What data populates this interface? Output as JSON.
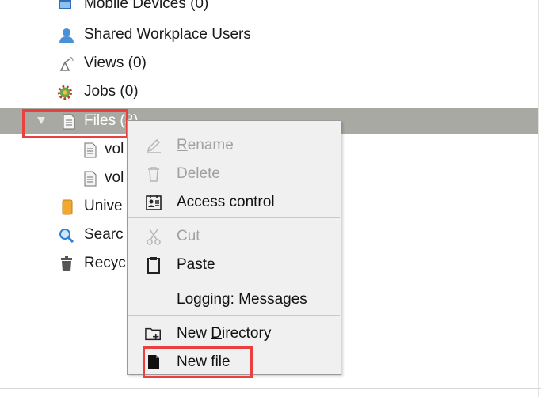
{
  "tree": {
    "items": [
      {
        "label": "Mobile Devices (0)",
        "icon": "mobile-devices-icon"
      },
      {
        "label": "Shared Workplace Users",
        "icon": "user-icon"
      },
      {
        "label": "Views (0)",
        "icon": "views-satellite-icon"
      },
      {
        "label": "Jobs (0)",
        "icon": "jobs-gear-icon"
      },
      {
        "label": "Files (3)",
        "label_short": "Files",
        "icon": "file-icon",
        "expanded": true,
        "selected": true
      },
      {
        "label": "vol",
        "icon": "file-icon"
      },
      {
        "label": "vol",
        "icon": "file-icon"
      },
      {
        "label": "Unive",
        "icon": "universe-book-icon"
      },
      {
        "label": "Searc",
        "icon": "search-icon"
      },
      {
        "label": "Recyc",
        "icon": "trash-icon"
      }
    ]
  },
  "context_menu": {
    "items": [
      {
        "label_pre": "",
        "label_ul": "R",
        "label_post": "ename",
        "enabled": false,
        "icon": "rename-pencil-icon"
      },
      {
        "label": "Delete",
        "enabled": false,
        "icon": "delete-trash-icon"
      },
      {
        "label": "Access control",
        "enabled": true,
        "icon": "access-control-icon"
      },
      {
        "label": "Cut",
        "enabled": false,
        "icon": "scissors-icon"
      },
      {
        "label": "Paste",
        "enabled": true,
        "icon": "clipboard-icon"
      },
      {
        "label": "Logging: Messages",
        "enabled": true
      },
      {
        "label_pre": "New ",
        "label_ul": "D",
        "label_post": "irectory",
        "enabled": true,
        "icon": "new-folder-icon"
      },
      {
        "label": "New file",
        "enabled": true,
        "icon": "new-file-icon"
      }
    ]
  },
  "colors": {
    "selection_bar": "#a9a9a4",
    "highlight_box": "#e8413f",
    "menu_background": "#f0f0f0",
    "disabled_text": "#a0a0a0"
  }
}
